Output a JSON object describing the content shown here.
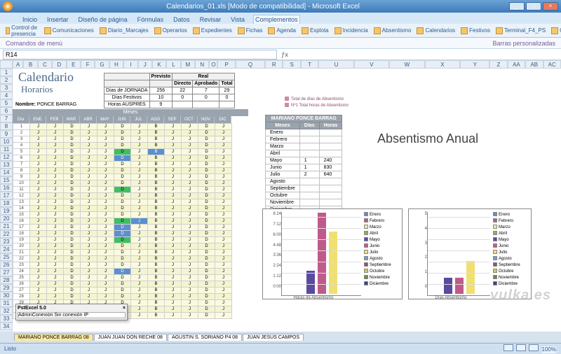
{
  "window": {
    "title": "Calendarios_01.xls [Modo de compatibilidad] - Microsoft Excel",
    "min": "_",
    "max": "□",
    "close": "×"
  },
  "tabs": [
    "Inicio",
    "Insertar",
    "Diseño de página",
    "Fórmulas",
    "Datos",
    "Revisar",
    "Vista",
    "Complementos"
  ],
  "active_tab": "Complementos",
  "ribbon_groups": [
    "Control de presencia",
    "Comunicaciones",
    "Diario_Marcajes",
    "Operarios",
    "Expedientes",
    "Fichas",
    "Agenda",
    "Explota",
    "Incidencia",
    "Absentismo",
    "Calendarios",
    "Festivos",
    "Terminal_F4_PS",
    "Configurar_Ficher"
  ],
  "namebox_left": "Comandos de menú",
  "namebox_right": "Barras personalizadas",
  "namebox": "R14",
  "calendar": {
    "title": "Calendario",
    "subtitle": "Horarios",
    "nombre_label": "Nombre:",
    "nombre_value": "PONCE BARRAG",
    "meses_label": "Meses",
    "small_table": {
      "col_headers": [
        "Previsto",
        "",
        "Real",
        ""
      ],
      "sub_headers": [
        "",
        "",
        "Directo",
        "Aprobado",
        "Total"
      ],
      "rows": [
        [
          "Días de JORNADA",
          "256",
          "22",
          "7",
          "29"
        ],
        [
          "Días Festivos",
          "10",
          "0",
          "0",
          "0"
        ],
        [
          "Horas AUSPRES",
          "9",
          "",
          "",
          ""
        ]
      ]
    },
    "month_headers": [
      "Día",
      "ENE",
      "FEB",
      "MAR",
      "ABR",
      "MAY",
      "JUN",
      "JUL",
      "AGO",
      "SEP",
      "OCT",
      "NOV",
      "DIC"
    ]
  },
  "side_table": {
    "legend": [
      "Total de días de Absentismo",
      "Nº1 Total horas de Absentismo"
    ],
    "header": "MARIANO PONCE BARRAG",
    "cols": [
      "Meses",
      "Días",
      "Horas"
    ],
    "rows": [
      [
        "Enero",
        "",
        ""
      ],
      [
        "Febrero",
        "",
        ""
      ],
      [
        "Marzo",
        "",
        ""
      ],
      [
        "Abril",
        "",
        ""
      ],
      [
        "Mayo",
        "1",
        "240"
      ],
      [
        "Junio",
        "1",
        "830"
      ],
      [
        "Julio",
        "2",
        "640"
      ],
      [
        "Agosto",
        "",
        ""
      ],
      [
        "Septiembre",
        "",
        ""
      ],
      [
        "Octubre",
        "",
        ""
      ],
      [
        "Noviembre",
        "",
        ""
      ],
      [
        "Diciembre",
        "",
        ""
      ]
    ]
  },
  "abs_title": "Absentismo Anual",
  "chart_data": [
    {
      "type": "bar",
      "title": "Horas de Absentismo",
      "categories": [
        "Mayo",
        "Junio",
        "Julio"
      ],
      "values": [
        2.4,
        8.3,
        6.4
      ],
      "y_ticks": [
        "0:00",
        "1:12",
        "2:24",
        "3:36",
        "4:48",
        "6:00",
        "7:12",
        "8:24"
      ],
      "colors": [
        "#5a4aa0",
        "#c05a8a",
        "#f0e070"
      ],
      "legend": [
        "Enero",
        "Febrero",
        "Marzo",
        "Abril",
        "Mayo",
        "Junio",
        "Julio",
        "Agosto",
        "Septiembre",
        "Octubre",
        "Noviembre",
        "Diciembre"
      ],
      "legend_colors": [
        "#6a8ad0",
        "#c05a7a",
        "#f0e890",
        "#8ab060",
        "#5a4aa0",
        "#c05a8a",
        "#f0e070",
        "#70a0c0",
        "#a04a6a",
        "#d0c860",
        "#6a8a50",
        "#404080"
      ]
    },
    {
      "type": "bar",
      "title": "Días Absentismo",
      "categories": [
        "Mayo",
        "Junio",
        "Julio"
      ],
      "values": [
        1,
        1,
        2
      ],
      "y_ticks": [
        "0",
        "1",
        "2",
        "3",
        "4",
        "5"
      ],
      "colors": [
        "#5a4aa0",
        "#c05a8a",
        "#f0e070"
      ],
      "legend": [
        "Enero",
        "Febrero",
        "Marzo",
        "Abril",
        "Mayo",
        "Junio",
        "Julio",
        "Agosto",
        "Septiembre",
        "Octubre",
        "Noviembre",
        "Diciembre"
      ],
      "legend_colors": [
        "#6a8ad0",
        "#c05a7a",
        "#f0e890",
        "#8ab060",
        "#5a4aa0",
        "#c05a8a",
        "#f0e070",
        "#70a0c0",
        "#a04a6a",
        "#d0c860",
        "#6a8a50",
        "#404080"
      ]
    }
  ],
  "popup": {
    "title": "PstExcel 5.0",
    "close": "×",
    "value": "AdminConexión Sin conexión IP"
  },
  "sheet_tabs": [
    "MARIANO PONCE BARRAG 08",
    "JUAN JUAN DON RECHE 08",
    "AGUSTIN S. SORIANO P4 08",
    "JUAN JESUS CAMPOS"
  ],
  "statusbar": {
    "mode": "Listo",
    "zoom": "100%"
  },
  "watermark": "vulka.es",
  "col_headers": [
    "A",
    "B",
    "C",
    "D",
    "E",
    "F",
    "G",
    "H",
    "I",
    "J",
    "K",
    "L",
    "M",
    "N",
    "O",
    "P",
    "Q",
    "R",
    "S",
    "T",
    "U",
    "V",
    "W",
    "X",
    "Y",
    "Z",
    "AA",
    "AB",
    "AC"
  ],
  "cal_pattern": {
    "letters": [
      "J",
      "J",
      "D",
      "J",
      "J",
      "D",
      "J",
      "B",
      "J",
      "J",
      "D",
      "J"
    ],
    "special": {
      "5": {
        "5": "gr",
        "7": "bl"
      },
      "6": {
        "5": "bl"
      },
      "11": {
        "5": "gr"
      },
      "16": {
        "5": "gr",
        "6": "bl"
      },
      "17": {
        "5": "bl"
      },
      "18": {
        "5": "bl"
      },
      "19": {
        "5": "gr"
      },
      "24": {
        "5": "bl"
      }
    }
  }
}
